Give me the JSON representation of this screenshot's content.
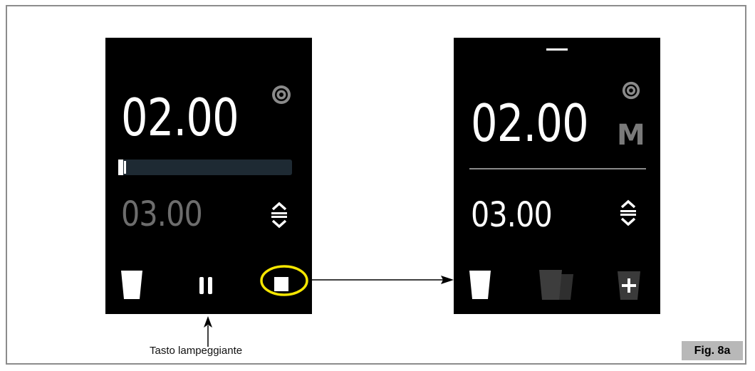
{
  "screen_left": {
    "time_main": "02.00",
    "time_secondary": "03.00",
    "progress_fraction": 0.03,
    "icons": [
      "target-icon",
      "up-down-arrows-icon",
      "cup-icon",
      "pause-icon",
      "stop-icon"
    ],
    "highlight_color": "#f5e600"
  },
  "screen_right": {
    "time_main": "02.00",
    "mode_letter": "M",
    "time_secondary": "03.00",
    "icons": [
      "dash-icon",
      "target-icon",
      "up-down-arrows-icon",
      "cup-icon",
      "double-cup-icon",
      "add-cup-icon"
    ]
  },
  "caption": "Tasto lampeggiante",
  "figure_label": "Fig. 8a"
}
